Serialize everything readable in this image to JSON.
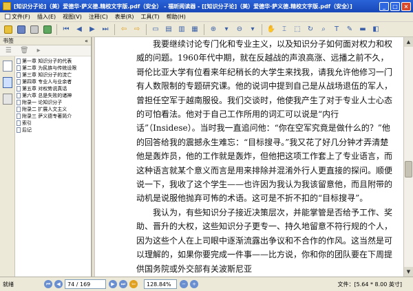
{
  "window": {
    "title": "[知识分子论]（美）爱德华·萨义德.精校文字版.pdf（安全） - 福昕阅读器 - [[知识分子论]（美）爱德华·萨义德.精校文字版.pdf（安全）]"
  },
  "menu": {
    "items": [
      "文件(F)",
      "插入(E)",
      "视图(V)",
      "注释(C)",
      "表单(R)",
      "工具(T)",
      "帮助(H)"
    ]
  },
  "sidebar": {
    "header": "书签",
    "collapse": "«",
    "items": [
      "第一章 知识分子的代表",
      "第二章 为民族与传统设限",
      "第三章 知识分子的流亡",
      "第四章 专业人与业余者",
      "第五章 对权势说真话",
      "第六章 总是失败的诸神",
      "附录一 论知识分子",
      "附录二 扩展人文主义",
      "附录三 萨义德专著简介",
      "索引",
      "后记"
    ]
  },
  "document": {
    "paragraphs": [
      "我要继续讨论专门化和专业主义，以及知识分子如何面对权力和权威的问题。1960年代中期，就在反越战的声浪高涨、远播之前不久，哥伦比亚大学有位看来年纪稍长的大学生来找我，请我允许他修习一门有人数限制的专题研究课。他的说词中提到自己是从战场退伍的军人，曾担任空军于越南服役。我们交谈时，他使我产生了对于专业人士心态的可怕看法。他对于自己工作所用的词汇可以说是“内行话”（Insidese）。当时我一直追问他：“你在空军究竟是做什么的？”他的回答给我的震撼永生难忘：“目标搜寻。”我又花了好几分钟才弄清楚他是轰炸员，他的工作就是轰炸，但他把这项工作套上了专业语言，而这种语言就某个意义而言是用来排除并混淆外行人更直接的探问。顺便说一下，我收了这个学生——也许因为我认为我该留意他，而且附带的动机是说服他抛弃可怖的术语。这可是不折不扣的“目标搜寻”。",
      "我认为，有些知识分子接近决策层次，并能掌管是否给予工作、奖助、晋升的大权，这些知识分子更专一、持久地留意不符行规的个人，因为这些个人在上司眼中逐渐流露出争议和不合作的作风。这当然是可以理解的，如果你要完成一件事——比方说，你和你的团队要在下周提供国务院或外交部有关波斯尼亚"
    ]
  },
  "status": {
    "ready": "就绪",
    "page_current": "74",
    "page_sep": "/",
    "page_total": "169",
    "zoom": "128.84%",
    "page_size": "文件：[5.64 * 8.00 英寸]"
  }
}
